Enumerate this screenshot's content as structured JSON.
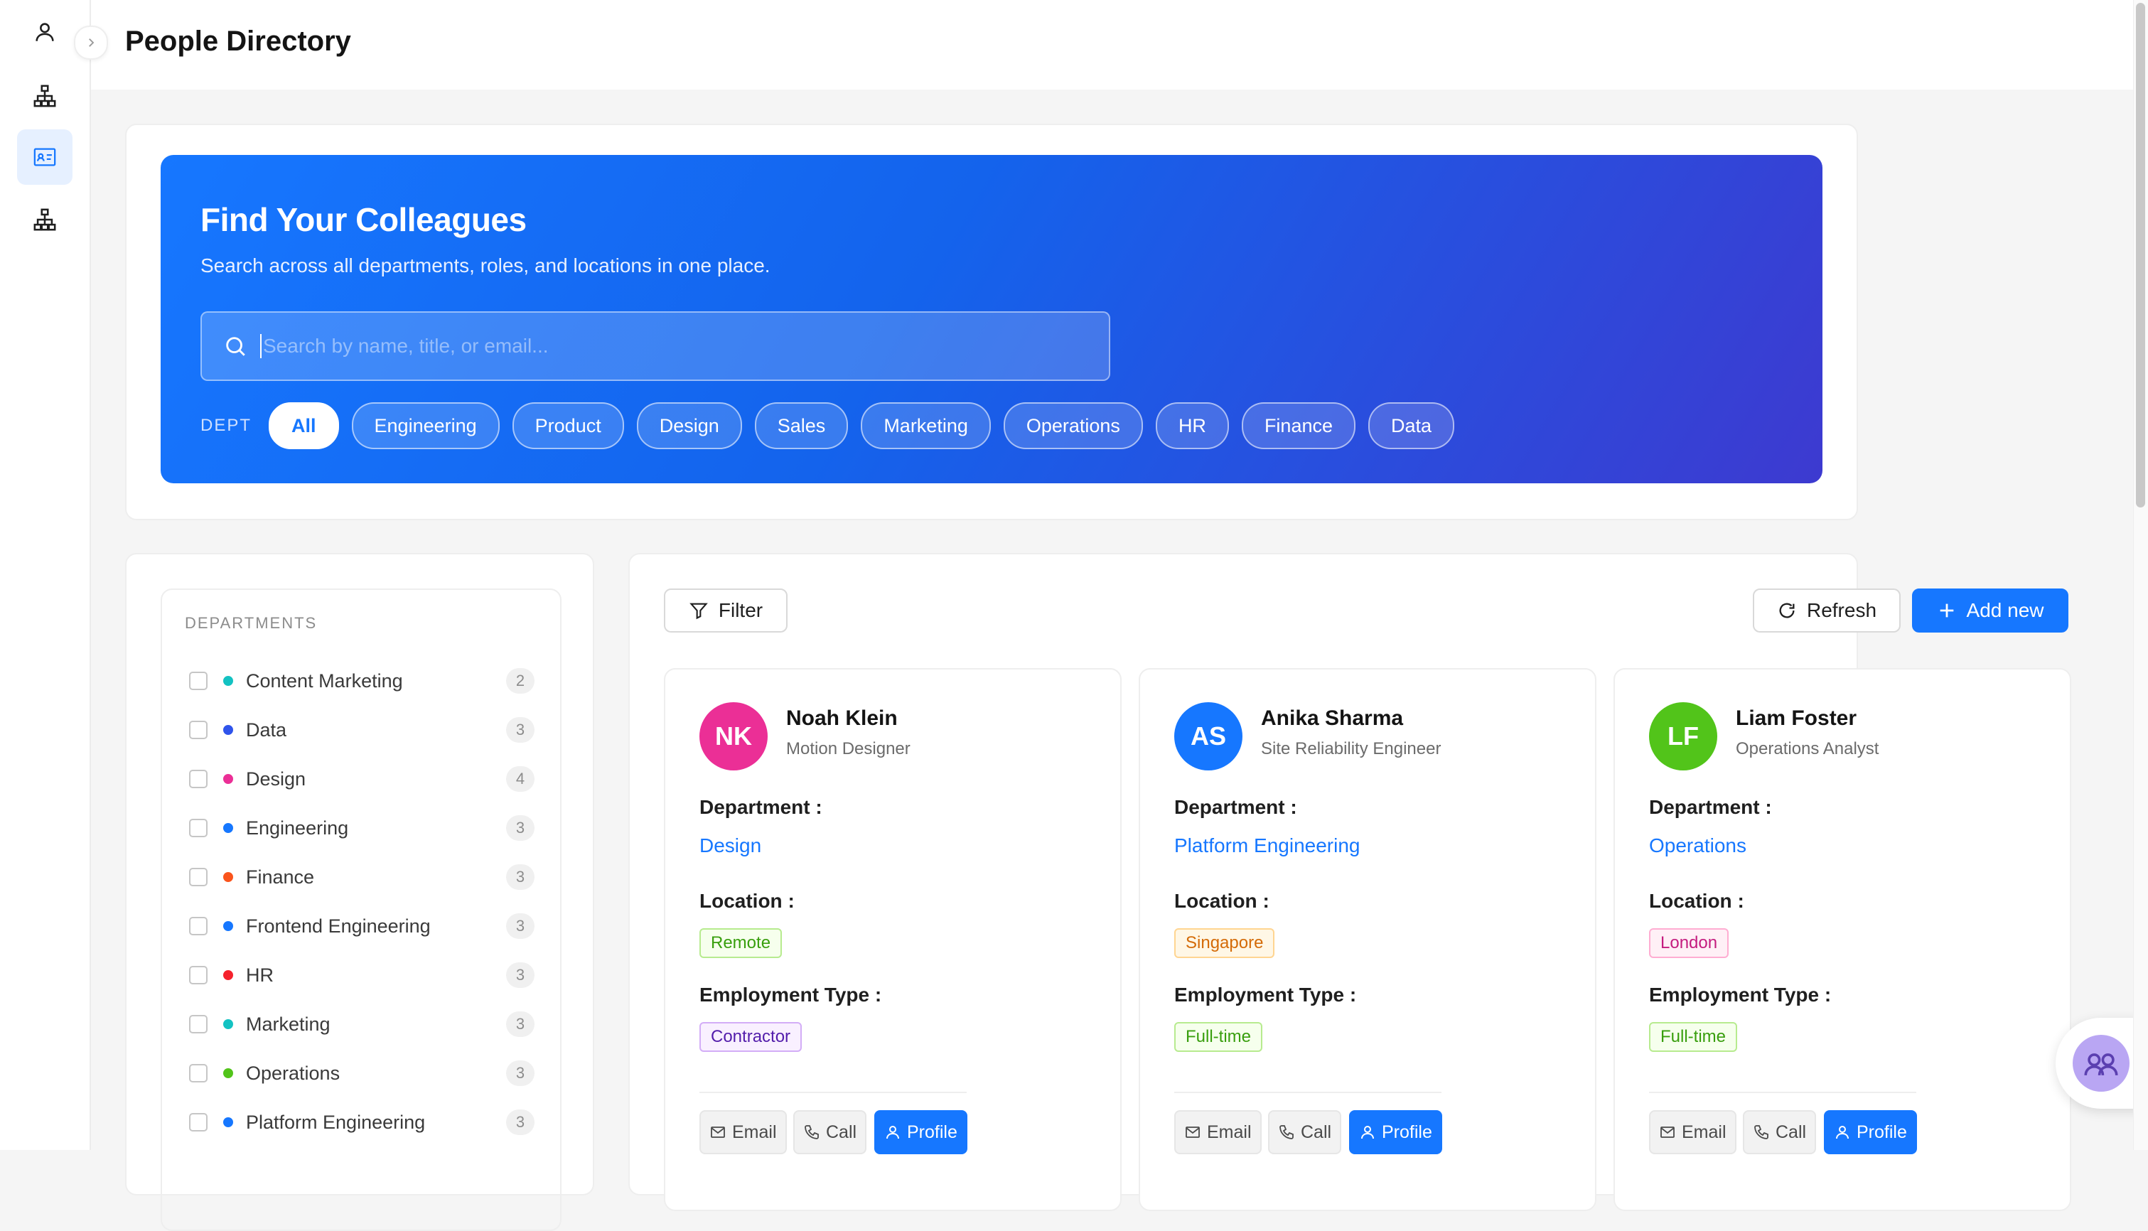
{
  "header": {
    "title": "People Directory"
  },
  "hero": {
    "title": "Find Your Colleagues",
    "subtitle": "Search across all departments, roles, and locations in one place.",
    "search_placeholder": "Search by name, title, or email...",
    "dept_label": "DEPT",
    "chips": [
      "All",
      "Engineering",
      "Product",
      "Design",
      "Sales",
      "Marketing",
      "Operations",
      "HR",
      "Finance",
      "Data"
    ],
    "active_chip": "All"
  },
  "departments": {
    "title": "DEPARTMENTS",
    "items": [
      {
        "name": "Content Marketing",
        "count": "2",
        "color": "#13c2c2"
      },
      {
        "name": "Data",
        "count": "3",
        "color": "#2f54eb"
      },
      {
        "name": "Design",
        "count": "4",
        "color": "#eb2f96"
      },
      {
        "name": "Engineering",
        "count": "3",
        "color": "#1677ff"
      },
      {
        "name": "Finance",
        "count": "3",
        "color": "#fa541c"
      },
      {
        "name": "Frontend Engineering",
        "count": "3",
        "color": "#1677ff"
      },
      {
        "name": "HR",
        "count": "3",
        "color": "#f5222d"
      },
      {
        "name": "Marketing",
        "count": "3",
        "color": "#13c2c2"
      },
      {
        "name": "Operations",
        "count": "3",
        "color": "#52c41a"
      },
      {
        "name": "Platform Engineering",
        "count": "3",
        "color": "#1677ff"
      }
    ]
  },
  "toolbar": {
    "filter_label": "Filter",
    "refresh_label": "Refresh",
    "add_label": "Add new"
  },
  "field_labels": {
    "department": "Department :",
    "location": "Location :",
    "employment_type": "Employment Type :"
  },
  "actions": {
    "email": "Email",
    "call": "Call",
    "profile": "Profile"
  },
  "people": [
    {
      "initials": "NK",
      "avatar_color": "#eb2f96",
      "name": "Noah Klein",
      "role": "Motion Designer",
      "department": "Design",
      "location": "Remote",
      "location_style": "green",
      "employment": "Contractor",
      "employment_style": "purple"
    },
    {
      "initials": "AS",
      "avatar_color": "#1677ff",
      "name": "Anika Sharma",
      "role": "Site Reliability Engineer",
      "department": "Platform Engineering",
      "location": "Singapore",
      "location_style": "orange",
      "employment": "Full-time",
      "employment_style": "green"
    },
    {
      "initials": "LF",
      "avatar_color": "#52c41a",
      "name": "Liam Foster",
      "role": "Operations Analyst",
      "department": "Operations",
      "location": "London",
      "location_style": "magenta",
      "employment": "Full-time",
      "employment_style": "green"
    }
  ],
  "tag_styles": {
    "green": {
      "bg": "#f6ffed",
      "border": "#b7eb8f",
      "text": "#389e0d"
    },
    "orange": {
      "bg": "#fff7e6",
      "border": "#ffd591",
      "text": "#d46b08"
    },
    "magenta": {
      "bg": "#fff0f6",
      "border": "#ffadd2",
      "text": "#c41d7f"
    },
    "purple": {
      "bg": "#f9f0ff",
      "border": "#d3adf7",
      "text": "#531dab"
    }
  }
}
